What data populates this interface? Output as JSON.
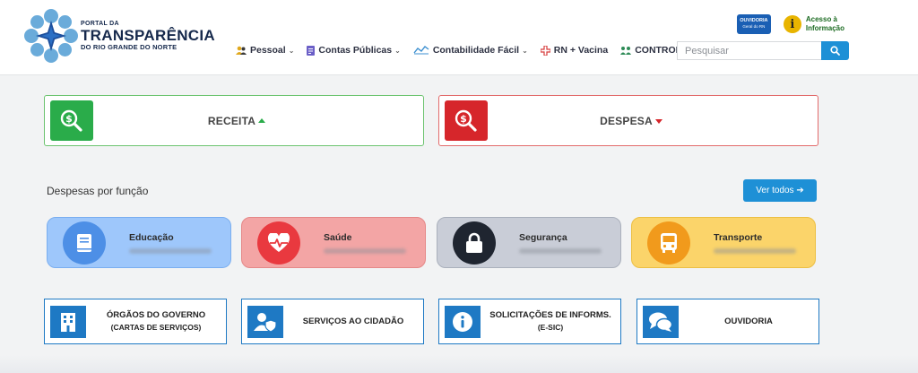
{
  "header": {
    "logo": {
      "small": "PORTAL DA",
      "big": "TRANSPARÊNCIA",
      "sub": "DO RIO GRANDE DO NORTE"
    },
    "ouvidoria_badge": {
      "title": "OUVIDORIA",
      "sub": "Geral do RN"
    },
    "acesso_informacao": {
      "line1": "Acesso à",
      "line2": "Informação"
    },
    "nav": [
      {
        "label": "Pessoal",
        "icon": "people-icon",
        "has_dropdown": true
      },
      {
        "label": "Contas Públicas",
        "icon": "document-icon",
        "has_dropdown": true
      },
      {
        "label": "Contabilidade Fácil",
        "icon": "chart-icon",
        "has_dropdown": true
      },
      {
        "label": "RN + Vacina",
        "icon": "cross-icon",
        "has_dropdown": false
      },
      {
        "label": "CONTROL",
        "icon": "control-icon",
        "has_dropdown": false
      }
    ],
    "search": {
      "placeholder": "Pesquisar"
    }
  },
  "summary": {
    "receita": {
      "label": "RECEITA"
    },
    "despesa": {
      "label": "DESPESA"
    }
  },
  "despesas_funcao": {
    "title": "Despesas por função",
    "ver_todos": "Ver todos",
    "cards": [
      {
        "name": "Educação"
      },
      {
        "name": "Saúde"
      },
      {
        "name": "Segurança"
      },
      {
        "name": "Transporte"
      }
    ]
  },
  "links": [
    {
      "title": "ÓRGÃOS DO GOVERNO",
      "sub": "(CARTAS DE SERVIÇOS)"
    },
    {
      "title": "SERVIÇOS AO CIDADÃO",
      "sub": ""
    },
    {
      "title": "SOLICITAÇÕES DE INFORMS.",
      "sub": "(E-SIC)"
    },
    {
      "title": "OUVIDORIA",
      "sub": ""
    }
  ],
  "colors": {
    "receita": "#2aac4a",
    "despesa": "#d6262b",
    "primary": "#1e90d6",
    "link_blue": "#1e79c4",
    "logo_navy": "#16294c"
  }
}
